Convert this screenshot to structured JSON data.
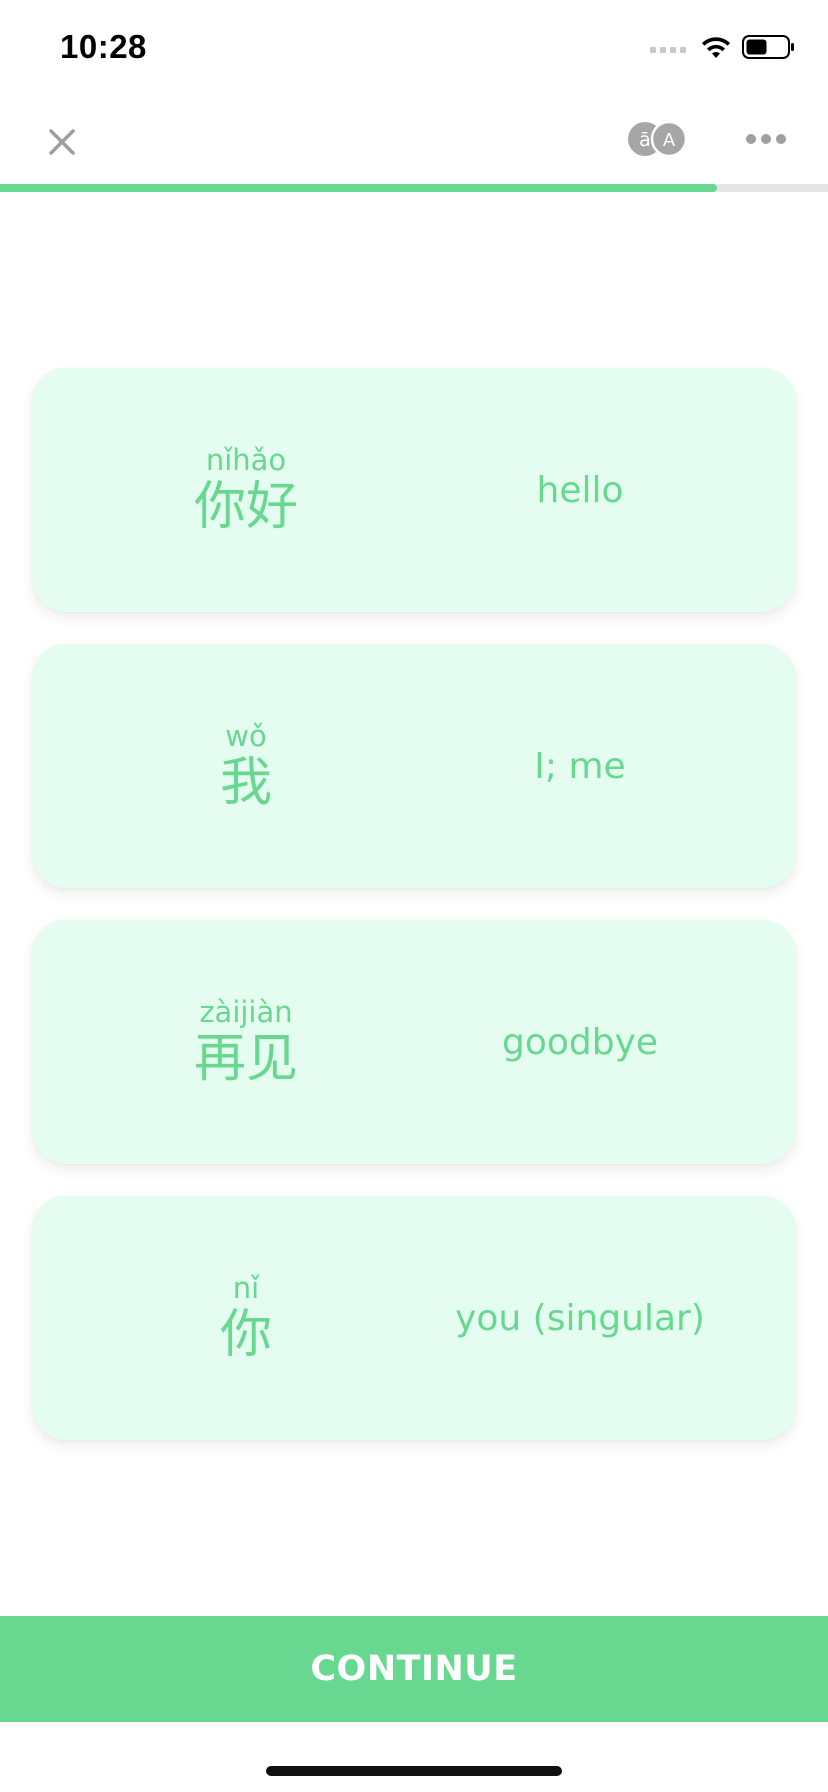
{
  "status_bar": {
    "time": "10:28"
  },
  "header": {
    "close_label": "X",
    "pinyin_toggle_icon": "pinyin-hanzi-toggle-icon",
    "more_icon": "more-dots-icon"
  },
  "progress": {
    "value": 0.866
  },
  "cards": [
    {
      "pinyin": "nǐhǎo",
      "hanzi": "你好",
      "meaning": "hello"
    },
    {
      "pinyin": "wǒ",
      "hanzi": "我",
      "meaning": "I; me"
    },
    {
      "pinyin": "zàijiàn",
      "hanzi": "再见",
      "meaning": "goodbye"
    },
    {
      "pinyin": "nǐ",
      "hanzi": "你",
      "meaning": "you (singular)"
    }
  ],
  "continue_label": "CONTINUE",
  "colors": {
    "accent": "#68d891",
    "card_bg": "#e5fcf0",
    "progress_track": "#e6e6e6",
    "icon_gray": "#9e9e9e"
  }
}
